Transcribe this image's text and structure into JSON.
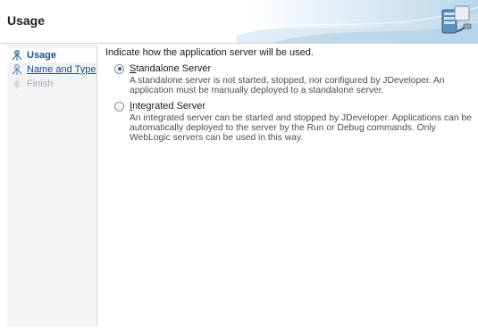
{
  "header": {
    "title": "Usage",
    "graphic_icon": "server-connection-icon",
    "accent_color": "#b9d6ea"
  },
  "nav": {
    "items": [
      {
        "label": "Usage",
        "state": "current",
        "icon": "step-current-icon"
      },
      {
        "label": "Name and Type",
        "state": "link",
        "icon": "step-icon"
      },
      {
        "label": "Finish",
        "state": "disabled",
        "icon": "step-disabled-icon"
      }
    ]
  },
  "content": {
    "instruction": "Indicate how  the application server will be used.",
    "options": [
      {
        "mnemonic": "S",
        "label_rest": "tandalone Server",
        "checked": true,
        "description": "A standalone server is not started, stopped, nor configured by JDeveloper. An application must be manually deployed to a standalone server."
      },
      {
        "mnemonic": "I",
        "label_rest": "ntegrated Server",
        "checked": false,
        "description": "An integrated server can be started and stopped by JDeveloper. Applications can be automatically deployed to the server by the Run or Debug commands. Only WebLogic servers can be used in this way."
      }
    ]
  }
}
